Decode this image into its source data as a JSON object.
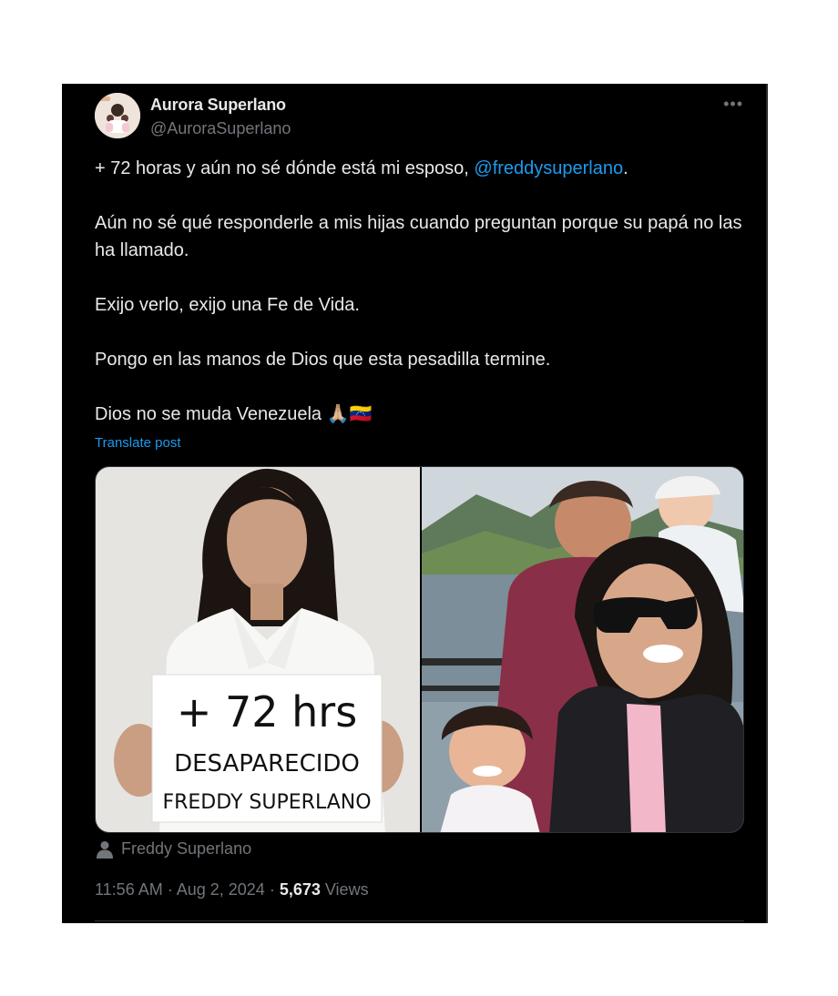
{
  "tweet": {
    "author_name": "Aurora Superlano",
    "author_handle": "@AuroraSuperlano",
    "more_label": "•••",
    "line1_prefix": "+ 72 horas y aún no sé dónde está mi esposo, ",
    "line1_mention": "@freddysuperlano",
    "line1_suffix": ".",
    "para2": "Aún no sé qué responderle a mis hijas cuando preguntan porque su papá no las ha llamado.",
    "para3": "Exijo verlo, exijo una Fe de Vida.",
    "para4": "Pongo en las manos de Dios que esta pesadilla termine.",
    "para5": "Dios no se muda Venezuela 🙏🏼🇻🇪",
    "translate_label": "Translate post",
    "tagged_person": "Freddy Superlano",
    "time": "11:56 AM",
    "separator": " · ",
    "date": "Aug 2, 2024",
    "views_count": "5,673",
    "views_label": " Views"
  },
  "sign": {
    "line1": "+ 72 hrs",
    "line2": "DESAPARECIDO",
    "line3": "FREDDY SUPERLANO"
  },
  "colors": {
    "background": "#000000",
    "text": "#e7e9ea",
    "secondary": "#71767b",
    "link": "#1d9bf0"
  },
  "icons": {
    "more": "more-dots-icon",
    "tag": "person-tag-icon"
  }
}
